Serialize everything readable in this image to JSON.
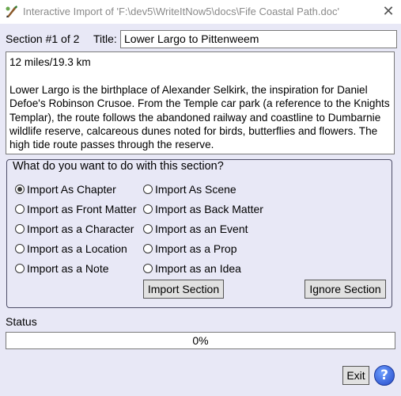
{
  "window": {
    "title": "Interactive Import of 'F:\\dev5\\WriteItNow5\\docs\\Fife Coastal Path.doc'",
    "close_glyph": "✕"
  },
  "section": {
    "counter": "Section #1 of 2",
    "title_label": "Title:",
    "title_value": "Lower Largo to Pittenweem"
  },
  "description": {
    "line1": "12 miles/19.3 km",
    "body": "Lower Largo is the birthplace of Alexander Selkirk, the inspiration for Daniel Defoe's Robinson Crusoe. From the Temple car park (a reference to the Knights Templar), the route follows the abandoned railway and coastline to Dumbarnie wildlife reserve, calcareous dunes noted for birds, butterflies and flowers. The high tide route passes through the reserve."
  },
  "options": {
    "legend": "What do you want to do with this section?",
    "selected": "Import As Chapter",
    "items": [
      "Import As Chapter",
      "Import As Scene",
      "Import as Front Matter",
      "Import as Back Matter",
      "Import as a Character",
      "Import as an Event",
      "Import as a Location",
      "Import as a Prop",
      "Import as a Note",
      "Import as an Idea"
    ],
    "import_button": "Import Section",
    "ignore_button": "Ignore Section"
  },
  "status": {
    "label": "Status",
    "progress_text": "0%",
    "progress_value": 0
  },
  "footer": {
    "exit_button": "Exit",
    "help_glyph": "?"
  }
}
